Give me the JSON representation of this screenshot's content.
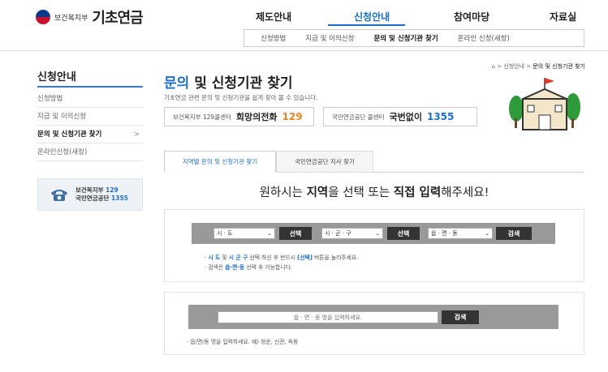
{
  "header": {
    "ministry": "보건복지부",
    "brand": "기초연금",
    "gnb": [
      "제도안내",
      "신청안내",
      "참여마당",
      "자료실"
    ],
    "subnav": [
      "신청방법",
      "지급 및 이의신청",
      "문의 및 신청기관 찾기",
      "온라인 신청(새창)"
    ]
  },
  "sidebar": {
    "title": "신청안내",
    "items": [
      {
        "label": "신청방법"
      },
      {
        "label": "지급 및 이의신청"
      },
      {
        "label": "문의 및 신청기관 찾기",
        "chevron": ">"
      },
      {
        "label": "온라인신청(새창)"
      }
    ],
    "callbox": {
      "line1_name": "보건복지부",
      "line1_num": "129",
      "line2_name": "국민연금공단",
      "line2_num": "1355"
    }
  },
  "breadcrumb": {
    "trail": "> 신청안내 >",
    "current": "문의 및 신청기관 찾기"
  },
  "main": {
    "title_blue": "문의",
    "title_rest": " 및 신청기관 찾기",
    "desc": "기초연금 관련 문의 및 신청기관을 쉽게 찾아 볼 수 있습니다.",
    "hotline1": {
      "label": "보건복지부 129콜센터",
      "name": "희망의전화",
      "num": "129"
    },
    "hotline2": {
      "label": "국민연금공단 콜센터",
      "name": "국번없이",
      "num": "1355"
    },
    "tabs": [
      "지역별 문의 및 신청기관 찾기",
      "국민연금공단 지사 찾기"
    ],
    "headline": {
      "p1": "원하시는 ",
      "b1": "지역",
      "p2": "을 선택 또는 ",
      "b2": "직접 입력",
      "p3": "해주세요!"
    },
    "selects": [
      {
        "value": "시 · 도",
        "button": "선택"
      },
      {
        "value": "시 · 군 · 구",
        "button": "선택"
      },
      {
        "value": "읍 · 면 · 동",
        "button": "검색"
      }
    ],
    "notes1": {
      "a1": "시 도",
      "a2": " 및 ",
      "a3": "시 군 구",
      "a4": " 선택 하신 후 반드시 ",
      "a5": "[선택]",
      "a6": " 버튼을 눌러주세요.",
      "b1": "검색은 ",
      "b2": "읍·면·동",
      "b3": " 선택 후 가능합니다."
    },
    "search": {
      "placeholder": "읍 · 면 · 동 명을 입력하세요.",
      "button": "검색",
      "note": "읍/면/동 명을 입력하세요. 예) 청운, 신관, 옥동"
    }
  }
}
